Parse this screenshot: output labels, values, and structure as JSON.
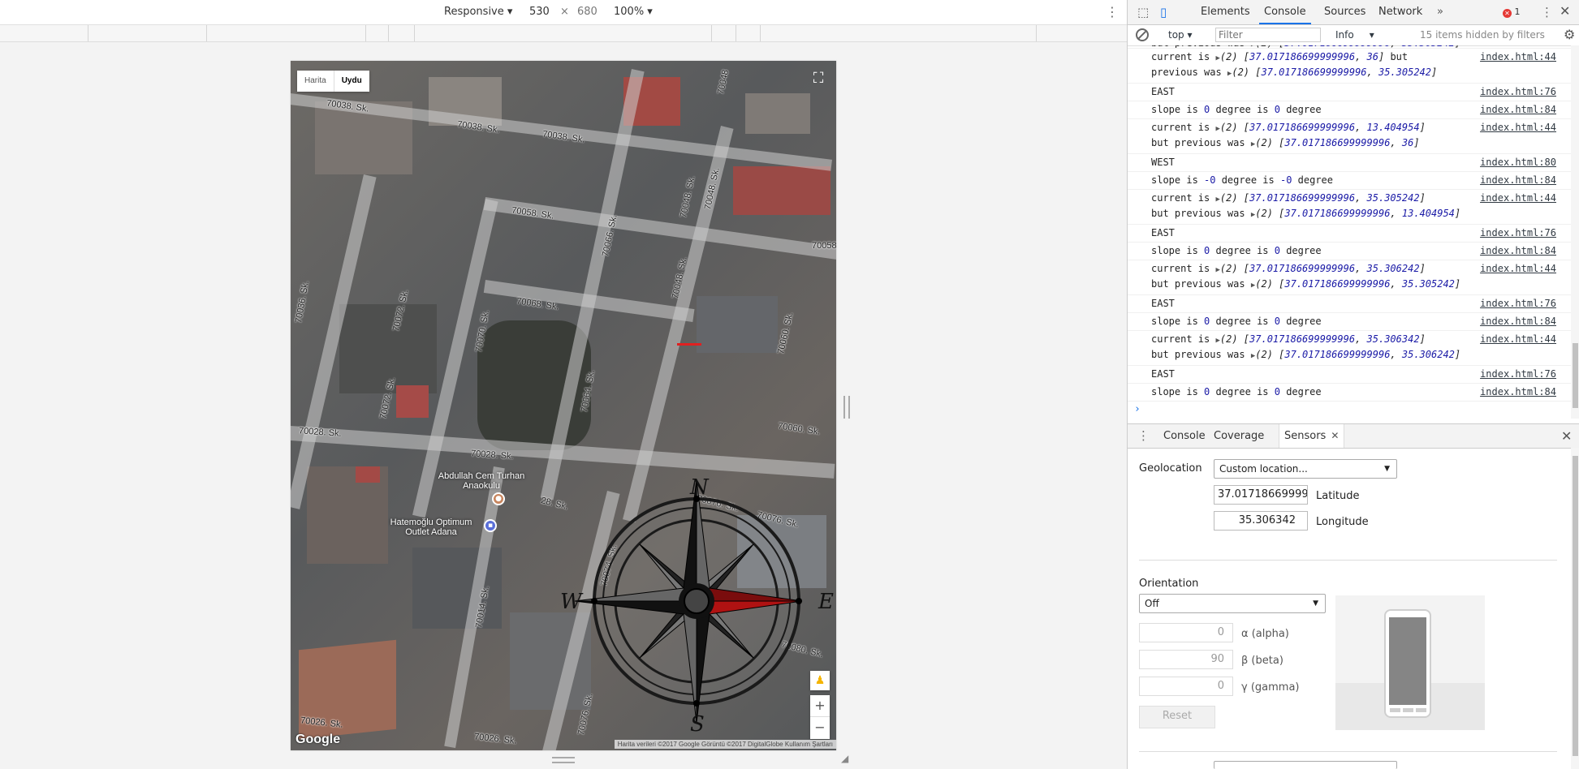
{
  "device_toolbar": {
    "device": "Responsive",
    "width": "530",
    "times": "×",
    "height": "680",
    "zoom": "100%"
  },
  "map": {
    "type_buttons": {
      "harita": "Harita",
      "uydu": "Uydu"
    },
    "road_labels": [
      "70038. Sk.",
      "70038. Sk.",
      "70038. Sk.",
      "70058. Sk.",
      "70058",
      "70068. Sk.",
      "70066. Sk.",
      "70048. Sk.",
      "70048. Sk.",
      "70036. Sk.",
      "70072. Sk.",
      "70070. Sk.",
      "70064. Sk.",
      "70072. Sk.",
      "70060. Sk.",
      "70028. Sk.",
      "70028. Sk.",
      "70060. Sk.",
      "70076. Sk.",
      "70076. Sk.",
      "28. Sk.",
      "70074. Sk.",
      "70014. Sk.",
      "70080. Sk.",
      "70076. Sk.",
      "70026. Sk.",
      "70026. Sk.",
      "70048",
      "70048. Sk."
    ],
    "poi": {
      "school": "Abdullah Cem Turhan Anaokulu",
      "store": "Hatemoğlu Optimum Outlet Adana"
    },
    "compass_letters": {
      "n": "N",
      "s": "S",
      "e": "E",
      "w": "W"
    },
    "google": "Google",
    "attribution": "Harita verileri ©2017 Google Görüntü ©2017 DigitalGlobe   Kullanım Şartları",
    "zoom_in": "+",
    "zoom_out": "−"
  },
  "devtools": {
    "tabs": {
      "elements": "Elements",
      "console": "Console",
      "sources": "Sources",
      "network": "Network",
      "more": "»"
    },
    "error_count": "1",
    "console_toolbar": {
      "context": "top",
      "filter_placeholder": "Filter",
      "level": "Info",
      "hidden": "15 items hidden by filters"
    },
    "log": [
      {
        "type": "pair",
        "prefix": "but previous was",
        "v1": "37.017186699999996",
        "v2": "35.305242",
        "link": "",
        "cut": true
      },
      {
        "type": "current",
        "cur1": "37.017186699999996",
        "cur2": "36",
        "prev1": "37.017186699999996",
        "prev2": "35.305242",
        "link": "index.html:44",
        "wrap": true
      },
      {
        "type": "text",
        "text": "EAST",
        "link": "index.html:76"
      },
      {
        "type": "slope",
        "slope": "0",
        "degree": "0",
        "link": "index.html:84"
      },
      {
        "type": "current",
        "cur1": "37.017186699999996",
        "cur2": "13.404954",
        "prev1": "37.017186699999996",
        "prev2": "36",
        "link": "index.html:44"
      },
      {
        "type": "text",
        "text": "WEST",
        "link": "index.html:80"
      },
      {
        "type": "slope",
        "slope": "-0",
        "degree": "-0",
        "link": "index.html:84"
      },
      {
        "type": "current",
        "cur1": "37.017186699999996",
        "cur2": "35.305242",
        "prev1": "37.017186699999996",
        "prev2": "13.404954",
        "link": "index.html:44"
      },
      {
        "type": "text",
        "text": "EAST",
        "link": "index.html:76"
      },
      {
        "type": "slope",
        "slope": "0",
        "degree": "0",
        "link": "index.html:84"
      },
      {
        "type": "current",
        "cur1": "37.017186699999996",
        "cur2": "35.306242",
        "prev1": "37.017186699999996",
        "prev2": "35.305242",
        "link": "index.html:44"
      },
      {
        "type": "text",
        "text": "EAST",
        "link": "index.html:76"
      },
      {
        "type": "slope",
        "slope": "0",
        "degree": "0",
        "link": "index.html:84"
      },
      {
        "type": "current",
        "cur1": "37.017186699999996",
        "cur2": "35.306342",
        "prev1": "37.017186699999996",
        "prev2": "35.306242",
        "link": "index.html:44"
      },
      {
        "type": "text",
        "text": "EAST",
        "link": "index.html:76"
      },
      {
        "type": "slope",
        "slope": "0",
        "degree": "0",
        "link": "index.html:84"
      }
    ],
    "log_words": {
      "current_is": "current is",
      "but_previous_was": "but previous was",
      "but": "but",
      "previous_was": "previous was",
      "slope_is": "slope is",
      "degree_is": "degree is",
      "degree": "degree",
      "count": "(2)"
    },
    "prompt": "›",
    "drawer": {
      "tabs": {
        "console": "Console",
        "coverage": "Coverage",
        "sensors": "Sensors"
      }
    },
    "sensors": {
      "geolocation_label": "Geolocation",
      "geolocation_value": "Custom location...",
      "latitude_value": "37.017186699999996",
      "latitude_label": "Latitude",
      "longitude_value": "35.306342",
      "longitude_label": "Longitude",
      "orientation_label": "Orientation",
      "orientation_value": "Off",
      "alpha_value": "0",
      "alpha_label": "α (alpha)",
      "beta_value": "90",
      "beta_label": "β (beta)",
      "gamma_value": "0",
      "gamma_label": "γ (gamma)",
      "reset": "Reset"
    }
  },
  "colors": {
    "accent": "#1a73e8",
    "error": "#e53935",
    "compass_red": "#b01212",
    "number_blue": "#1a1aa6"
  }
}
